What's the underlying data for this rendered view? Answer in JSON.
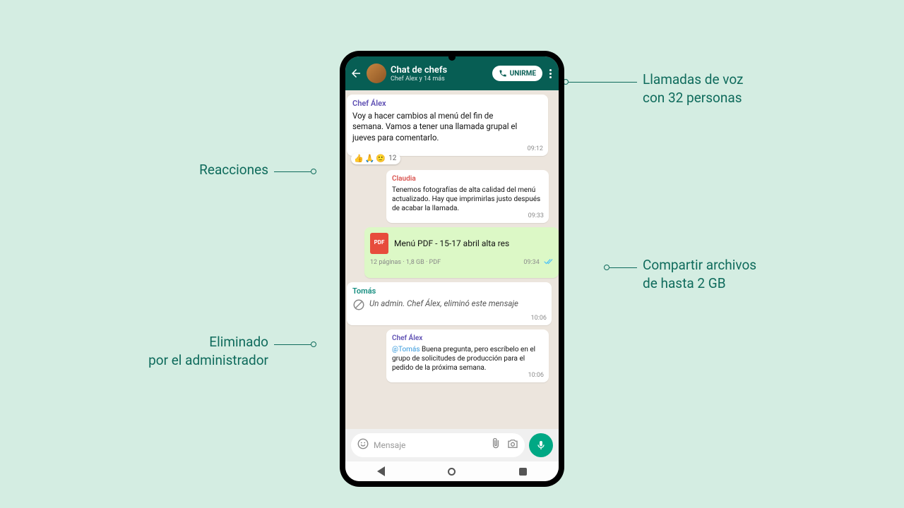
{
  "callouts": {
    "reactions": "Reacciones",
    "deleted_by_admin_l1": "Eliminado",
    "deleted_by_admin_l2": "por el administrador",
    "voice_calls_l1": "Llamadas de voz",
    "voice_calls_l2": "con 32 personas",
    "share_files_l1": "Compartir archivos",
    "share_files_l2": "de hasta 2 GB"
  },
  "toolbar": {
    "title": "Chat de chefs",
    "subtitle": "Chef Álex y 14 más",
    "join_label": "UNIRME"
  },
  "messages": {
    "m1_sender": "Chef Álex",
    "m1_text": "Voy a hacer cambios al menú del fin de semana. Vamos a tener una llamada grupal el jueves para comentarlo.",
    "m1_time": "09:12",
    "m1_react_e1": "👍",
    "m1_react_e2": "🙏",
    "m1_react_e3": "🙂",
    "m1_react_count": "12",
    "m2_sender": "Claudia",
    "m2_text": "Tenemos fotografías de alta calidad del menú actualizado. Hay que imprimirlas justo después de acabar la llamada.",
    "m2_time": "09:33",
    "m3_file_label": "PDF",
    "m3_file_name": "Menú PDF - 15-17 abril alta res",
    "m3_file_meta": "12 páginas · 1,8 GB · PDF",
    "m3_time": "09:34",
    "m4_sender": "Tomás",
    "m4_text": "Un admin. Chef Álex, eliminó este mensaje",
    "m4_time": "10:06",
    "m5_sender": "Chef Álex",
    "m5_mention": "@Tomás",
    "m5_text": " Buena pregunta, pero escríbelo en el grupo de solicitudes de producción para el pedido de la próxima semana.",
    "m5_time": "10:06"
  },
  "composer": {
    "placeholder": "Mensaje"
  }
}
